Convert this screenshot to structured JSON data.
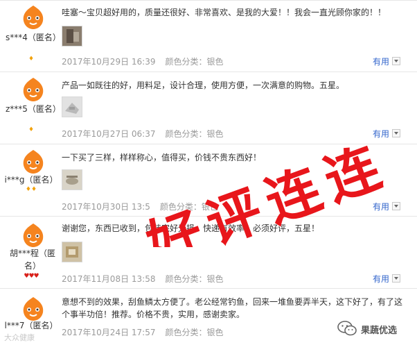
{
  "reviews": [
    {
      "user": "s***4（匿名）",
      "badge": "♦",
      "content": "哇塞～宝贝超好用的，质量还很好、非常喜欢、是我的大爱！！我会一直光顾你家的！！",
      "date": "2017年10月29日 16:39",
      "sku": "颜色分类：银色",
      "useful": "有用"
    },
    {
      "user": "z***5（匿名）",
      "badge": "♦",
      "content": "产品一如既往的好，用料足，设计合理，使用方便，一次满意的购物。五星。",
      "date": "2017年10月27日 06:37",
      "sku": "颜色分类：银色",
      "useful": "有用"
    },
    {
      "user": "i***g（匿名）",
      "badge": "♦♦",
      "content": "一下买了三样，样样称心，值得买，价钱不贵东西好！",
      "date": "2017年10月30日 13:5",
      "sku": "颜色分类：银色",
      "useful": "有用"
    },
    {
      "user": "胡***程（匿名）",
      "badge": "♥♥♥",
      "content": "谢谢您，东西已收到，包装完好无损，快递有效率，必须好评，五星！",
      "date": "2017年11月08日 13:58",
      "sku": "颜色分类：银色",
      "useful": "有用"
    },
    {
      "user": "l***7（匿名）",
      "badge": "",
      "content": "意想不到的效果，刮鱼鳞太方便了。老公经常钓鱼，回来一堆鱼要弄半天，这下好了，有了这个事半功倍！推荐。价格不贵，实用，感谢卖家。",
      "date": "2017年10月24日 17:57",
      "sku": "颜色分类：银色",
      "useful": "有用"
    }
  ],
  "overlay": {
    "text": "好评连连"
  },
  "watermark": {
    "text": "大众健康"
  },
  "brand": {
    "name": "果蔬优选"
  },
  "colors": {
    "overlay": "#e8161b",
    "link": "#3366cc",
    "meta": "#9a9a9a",
    "avatar": "#f5841f"
  }
}
